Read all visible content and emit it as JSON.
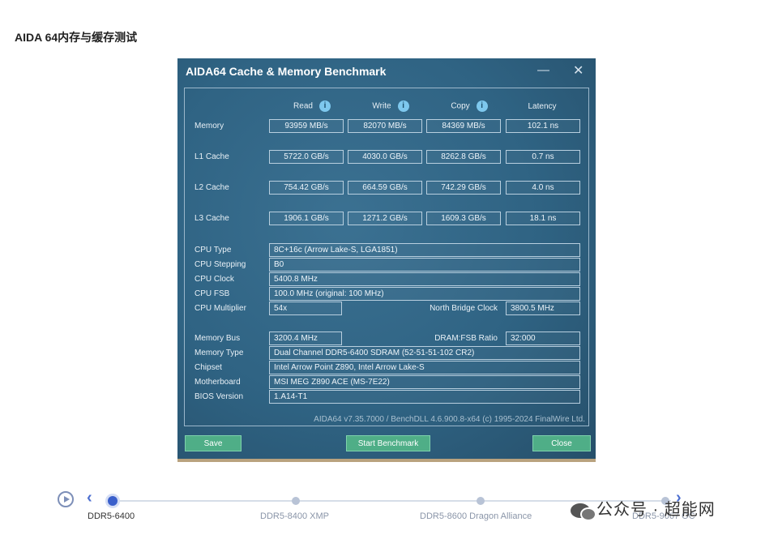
{
  "page": {
    "title": "AIDA 64内存与缓存测试"
  },
  "window": {
    "title": "AIDA64 Cache & Memory Benchmark",
    "minimize_glyph": "—",
    "close_glyph": "✕"
  },
  "bench": {
    "headers": [
      "Read",
      "Write",
      "Copy",
      "Latency"
    ],
    "info_icon": "i",
    "rows": [
      {
        "label": "Memory",
        "values": [
          "93959 MB/s",
          "82070 MB/s",
          "84369 MB/s",
          "102.1 ns"
        ]
      },
      {
        "label": "L1 Cache",
        "values": [
          "5722.0 GB/s",
          "4030.0 GB/s",
          "8262.8 GB/s",
          "0.7 ns"
        ]
      },
      {
        "label": "L2 Cache",
        "values": [
          "754.42 GB/s",
          "664.59 GB/s",
          "742.29 GB/s",
          "4.0 ns"
        ]
      },
      {
        "label": "L3 Cache",
        "values": [
          "1906.1 GB/s",
          "1271.2 GB/s",
          "1609.3 GB/s",
          "18.1 ns"
        ]
      }
    ]
  },
  "cpu": {
    "type": {
      "label": "CPU Type",
      "value": "8C+16c  (Arrow Lake-S, LGA1851)"
    },
    "stepping": {
      "label": "CPU Stepping",
      "value": "B0"
    },
    "clock": {
      "label": "CPU Clock",
      "value": "5400.8 MHz"
    },
    "fsb": {
      "label": "CPU FSB",
      "value": "100.0 MHz  (original: 100 MHz)"
    },
    "multiplier": {
      "label": "CPU Multiplier",
      "value": "54x"
    },
    "nb_clock": {
      "label": "North Bridge Clock",
      "value": "3800.5 MHz"
    }
  },
  "system": {
    "mem_bus": {
      "label": "Memory Bus",
      "value": "3200.4 MHz"
    },
    "dram_ratio": {
      "label": "DRAM:FSB Ratio",
      "value": "32:000"
    },
    "mem_type": {
      "label": "Memory Type",
      "value": "Dual Channel DDR5-6400 SDRAM  (52-51-51-102 CR2)"
    },
    "chipset": {
      "label": "Chipset",
      "value": "Intel Arrow Point Z890, Intel Arrow Lake-S"
    },
    "motherboard": {
      "label": "Motherboard",
      "value": "MSI MEG Z890 ACE (MS-7E22)"
    },
    "bios": {
      "label": "BIOS Version",
      "value": "1.A14-T1"
    }
  },
  "footer_note": "AIDA64 v7.35.7000 / BenchDLL 4.6.900.8-x64  (c) 1995-2024 FinalWire Ltd.",
  "buttons": {
    "save": "Save",
    "start": "Start Benchmark",
    "close": "Close"
  },
  "timeline": {
    "prev_glyph": "‹",
    "next_glyph": "›",
    "items": [
      "DDR5-6400",
      "DDR5-8400 XMP",
      "DDR5-8600 Dragon Alliance",
      "DDR5-9067 OC"
    ],
    "active_index": 0
  },
  "watermark": "公众号 · 超能网",
  "colors": {
    "accent": "#3a5fcb",
    "button": "#4fae87",
    "window_bg": "#2f6383"
  }
}
